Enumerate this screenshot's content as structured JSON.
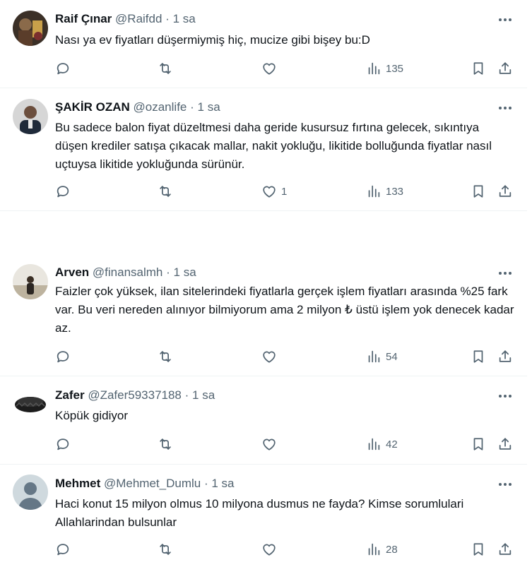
{
  "tweets": [
    {
      "name": "Raif Çınar",
      "handle": "@Raifdd",
      "time": "1 sa",
      "text": "Nası ya ev fiyatları düşermiymiş hiç, mucize gibi bişey bu:D",
      "likes": "",
      "views": "135"
    },
    {
      "name": "ŞAKİR OZAN",
      "handle": "@ozanlife",
      "time": "1 sa",
      "text": "Bu sadece balon fiyat düzeltmesi daha geride kusursuz fırtına gelecek, sıkıntıya düşen krediler satışa çıkacak mallar, nakit yokluğu, likitide bolluğunda fiyatlar nasıl uçtuysa likitide yokluğunda sürünür.",
      "likes": "1",
      "views": "133"
    },
    {
      "name": "Arven",
      "handle": "@finansalmh",
      "time": "1 sa",
      "text": "Faizler çok yüksek, ilan sitelerindeki fiyatlarla gerçek işlem fiyatları arasında %25 fark var. Bu veri nereden alınıyor bilmiyorum ama 2 milyon ₺ üstü işlem yok denecek kadar az.",
      "likes": "",
      "views": "54"
    },
    {
      "name": "Zafer",
      "handle": "@Zafer59337188",
      "time": "1 sa",
      "text": "Köpük gidiyor",
      "likes": "",
      "views": "42"
    },
    {
      "name": "Mehmet",
      "handle": "@Mehmet_Dumlu",
      "time": "1 sa",
      "text": "Haci konut 15 milyon olmus 10 milyona dusmus ne fayda? Kimse sorumlulari Allahlarindan bulsunlar",
      "likes": "",
      "views": "28"
    }
  ],
  "separator": "·",
  "icons": {
    "reply": "reply-icon",
    "retweet": "retweet-icon",
    "like": "heart-icon",
    "views": "views-icon",
    "bookmark": "bookmark-icon",
    "share": "share-icon",
    "more": "more-icon"
  }
}
